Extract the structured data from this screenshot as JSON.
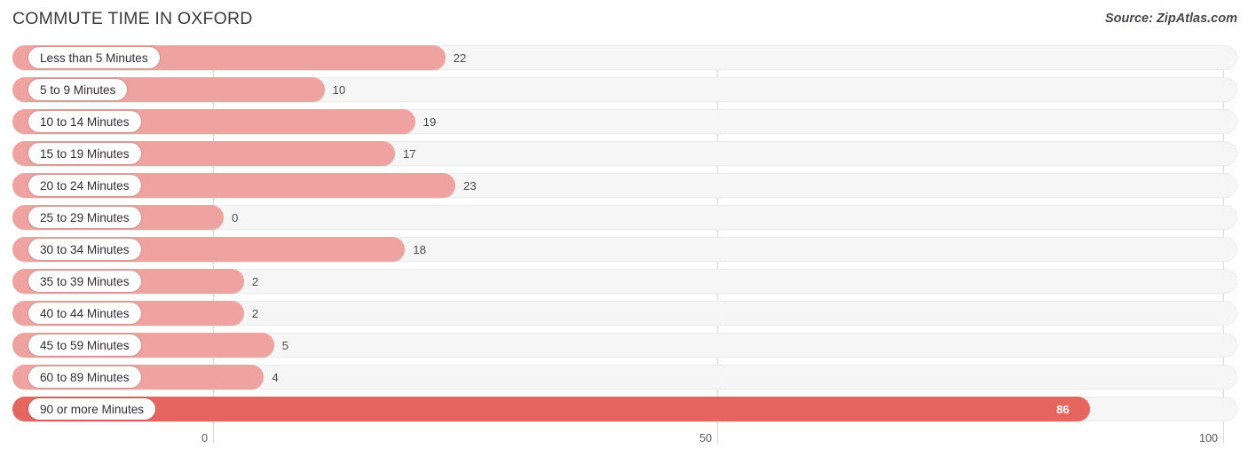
{
  "header": {
    "title": "COMMUTE TIME IN OXFORD",
    "source": "Source: ZipAtlas.com"
  },
  "colors": {
    "bar": "#EFA3A0",
    "bar_highlight": "#E4665F",
    "track": "#F6F6F6",
    "gridline": "#D8D8D8",
    "text": "#3B3B3B"
  },
  "chart_data": {
    "type": "bar",
    "orientation": "horizontal",
    "title": "COMMUTE TIME IN OXFORD",
    "xlabel": "",
    "ylabel": "",
    "xlim": [
      0,
      100
    ],
    "ticks": [
      "0",
      "50",
      "100"
    ],
    "tick_values": [
      0,
      50,
      100
    ],
    "grid": true,
    "legend": null,
    "categories": [
      "Less than 5 Minutes",
      "5 to 9 Minutes",
      "10 to 14 Minutes",
      "15 to 19 Minutes",
      "20 to 24 Minutes",
      "25 to 29 Minutes",
      "30 to 34 Minutes",
      "35 to 39 Minutes",
      "40 to 44 Minutes",
      "45 to 59 Minutes",
      "60 to 89 Minutes",
      "90 or more Minutes"
    ],
    "values": [
      22,
      10,
      19,
      17,
      23,
      0,
      18,
      2,
      2,
      5,
      4,
      86
    ],
    "value_labels": [
      "22",
      "10",
      "19",
      "17",
      "23",
      "0",
      "18",
      "2",
      "2",
      "5",
      "4",
      "86"
    ],
    "highlight_index": 11
  }
}
